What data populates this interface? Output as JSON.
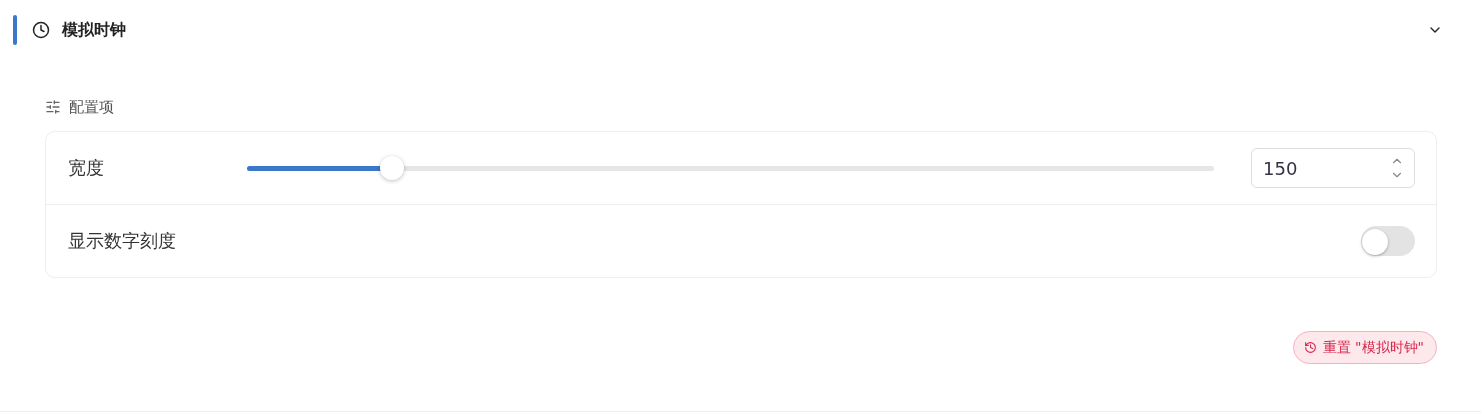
{
  "section": {
    "title": "模拟时钟",
    "expanded": true
  },
  "config": {
    "label": "配置项"
  },
  "settings": [
    {
      "kind": "slider",
      "label": "宽度",
      "level": 0.15,
      "value": "150"
    },
    {
      "kind": "switch",
      "label": "显示数字刻度",
      "on": false
    }
  ],
  "reset_button": {
    "label": "重置 \"模拟时钟\""
  }
}
